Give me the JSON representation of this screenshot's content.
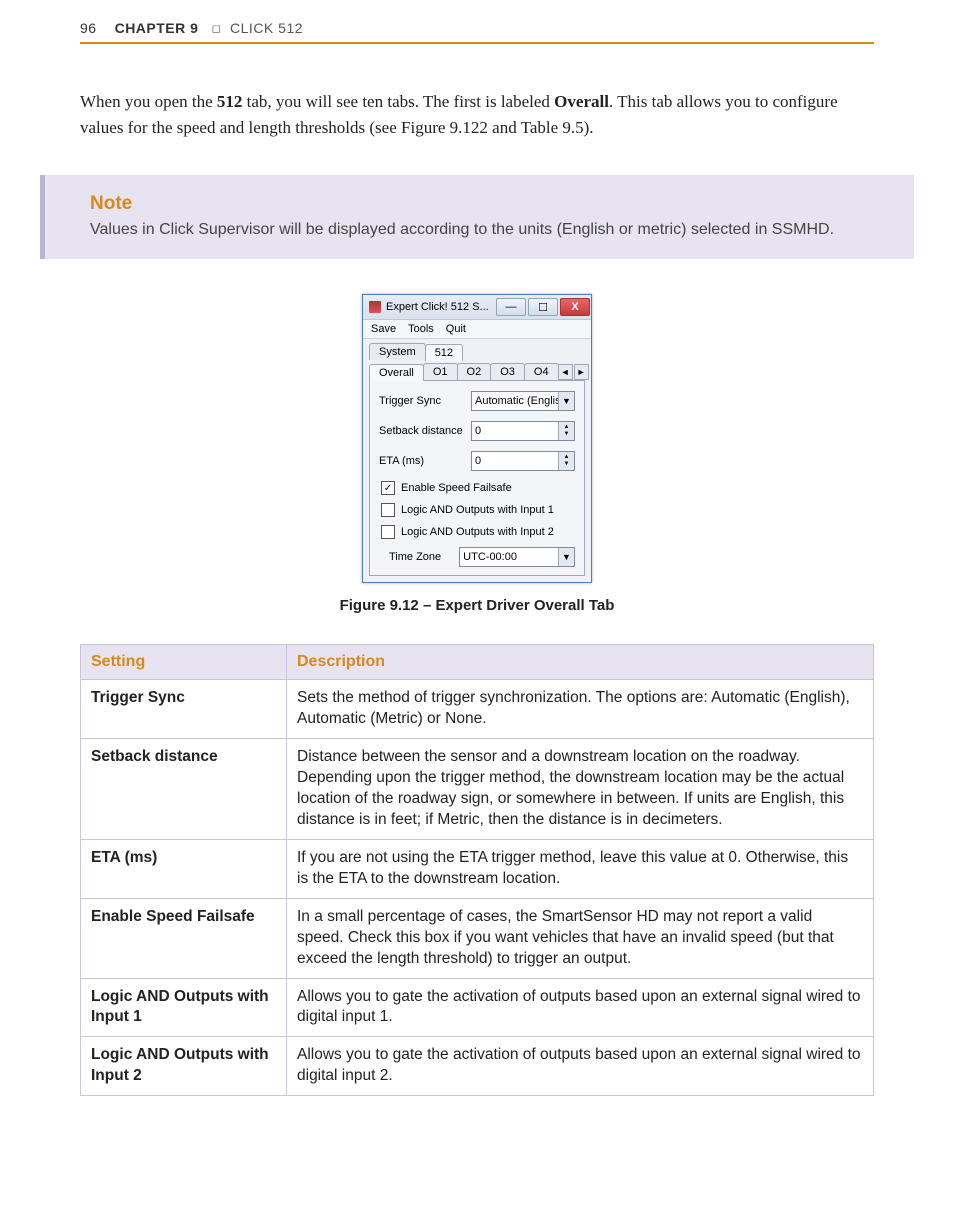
{
  "header": {
    "page_num": "96",
    "chapter_label": "CHAPTER 9",
    "divider_glyph": "◻",
    "chapter_title": "CLICK 512"
  },
  "intro": {
    "pre_tab": "When you open the ",
    "tab_bold": "512",
    "mid1": " tab, you will see ten tabs. The first is labeled ",
    "overall_bold": "Overall",
    "tail": ". This tab allows you to configure values for the speed and length thresholds (see Figure 9.122 and Table 9.5)."
  },
  "note": {
    "title": "Note",
    "body": "Values in Click Supervisor will be displayed according to the units (English or metric) selected in SSMHD."
  },
  "dialog": {
    "title": "Expert Click! 512 S...",
    "win_min": "—",
    "win_max": "☐",
    "win_close": "X",
    "menu": {
      "save": "Save",
      "tools": "Tools",
      "quit": "Quit"
    },
    "tabs_top": {
      "system": "System",
      "t512": "512"
    },
    "tabs_sub": {
      "overall": "Overall",
      "o1": "O1",
      "o2": "O2",
      "o3": "O3",
      "o4": "O4"
    },
    "tab_scroll_l": "◄",
    "tab_scroll_r": "►",
    "fields": {
      "trigger_sync_lbl": "Trigger Sync",
      "trigger_sync_val": "Automatic (English)",
      "setback_lbl": "Setback distance",
      "setback_val": "0",
      "eta_lbl": "ETA (ms)",
      "eta_val": "0",
      "cb1_checked": "✓",
      "cb1_lbl": "Enable Speed Failsafe",
      "cb2_lbl": "Logic AND Outputs with Input 1",
      "cb3_lbl": "Logic AND Outputs with Input 2",
      "tz_lbl": "Time Zone",
      "tz_val": "UTC-00:00"
    }
  },
  "figure_caption": "Figure 9.12 – Expert Driver Overall Tab",
  "table": {
    "head_setting": "Setting",
    "head_desc": "Description",
    "rows": [
      {
        "name": "Trigger Sync",
        "desc": "Sets the method of trigger synchronization. The options are: Automatic (English), Automatic (Metric) or None."
      },
      {
        "name": "Setback distance",
        "desc": "Distance between the sensor and a downstream location on the roadway. Depending upon the trigger method, the downstream location may be the actual location of the roadway sign, or somewhere in between. If units are English, this distance is in feet; if Metric, then the distance is in decimeters."
      },
      {
        "name": "ETA (ms)",
        "desc": "If you are not using the ETA trigger method, leave this value at 0. Otherwise, this is the ETA to the downstream location."
      },
      {
        "name": "Enable Speed Failsafe",
        "desc": "In a small percentage of cases, the SmartSensor HD may not report a valid speed. Check this box if you want vehicles that have an invalid speed (but that exceed the length threshold) to trigger an output."
      },
      {
        "name": "Logic AND Outputs with Input 1",
        "desc": "Allows you to gate the activation of outputs based upon an external signal wired to digital input 1."
      },
      {
        "name": "Logic AND Outputs with Input 2",
        "desc": "Allows you to gate the activation of outputs based upon an external signal wired to digital input 2."
      }
    ]
  }
}
